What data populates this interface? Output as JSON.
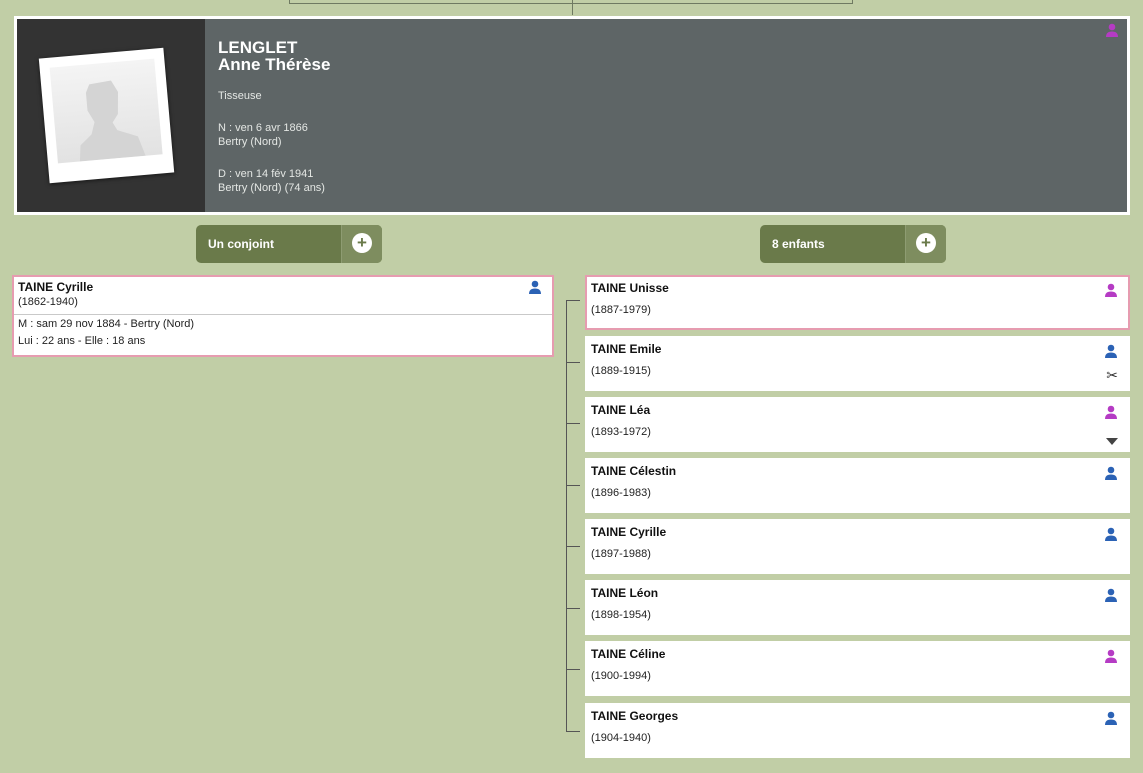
{
  "colors": {
    "male": "#2b62b5",
    "female": "#b53bc4",
    "highlight": "#e69cb0"
  },
  "person": {
    "surname": "LENGLET",
    "given": "Anne Thérèse",
    "occupation": "Tisseuse",
    "birth": "N : ven 6 avr 1866",
    "birth_place": "Bertry (Nord)",
    "death": "D : ven 14 fév 1941",
    "death_place": "Bertry (Nord) (74 ans)",
    "gender_icon": "female-user-icon"
  },
  "spouses_button": {
    "label": "Un conjoint",
    "add_icon": "plus-icon"
  },
  "children_button": {
    "label": "8 enfants",
    "add_icon": "plus-icon"
  },
  "spouse": {
    "name": "TAINE Cyrille",
    "dates": "(1862-1940)",
    "marriage": "M : sam 29 nov 1884 - Bertry (Nord)",
    "ages": "Lui : 22 ans - Elle : 18 ans",
    "gender_icon": "male-user-icon"
  },
  "children": [
    {
      "name": "TAINE Unisse",
      "dates": "(1887-1979)",
      "gender": "female"
    },
    {
      "name": "TAINE Emile",
      "dates": "(1889-1915)",
      "gender": "male",
      "action_icon": "scissors-icon"
    },
    {
      "name": "TAINE Léa",
      "dates": "(1893-1972)",
      "gender": "female",
      "action_icon": "caret-down-icon"
    },
    {
      "name": "TAINE Célestin",
      "dates": "(1896-1983)",
      "gender": "male"
    },
    {
      "name": "TAINE Cyrille",
      "dates": "(1897-1988)",
      "gender": "male"
    },
    {
      "name": "TAINE Léon",
      "dates": "(1898-1954)",
      "gender": "male"
    },
    {
      "name": "TAINE Céline",
      "dates": "(1900-1994)",
      "gender": "female"
    },
    {
      "name": "TAINE Georges",
      "dates": "(1904-1940)",
      "gender": "male"
    }
  ]
}
